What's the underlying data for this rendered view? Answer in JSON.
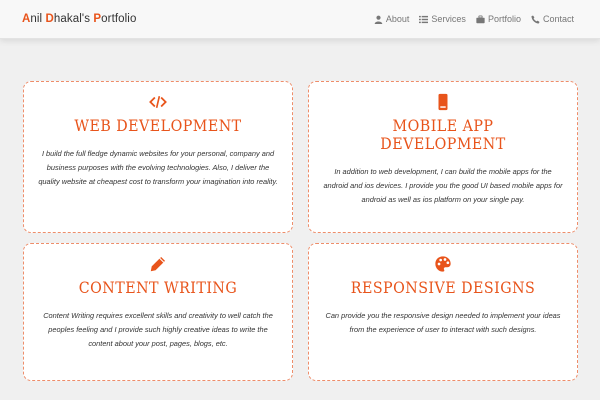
{
  "brand": {
    "c1": "A",
    "r1": "nil ",
    "c2": "D",
    "r2": "hakal's ",
    "c3": "P",
    "r3": "ortfolio"
  },
  "nav": [
    {
      "label": "About",
      "icon": "user-icon"
    },
    {
      "label": "Services",
      "icon": "list-icon"
    },
    {
      "label": "Portfolio",
      "icon": "briefcase-icon"
    },
    {
      "label": "Contact",
      "icon": "phone-icon"
    }
  ],
  "colors": {
    "accent": "#e8541b",
    "card_border": "#ee8d6a",
    "background": "#f0f0f0"
  },
  "services": [
    {
      "icon": "code-icon",
      "title": "Web Development",
      "description": "I build the full fledge dynamic websites for your personal, company and business purposes with the evolving technologies. Also, I deliver the quality website at cheapest cost to transform your imagination into reality."
    },
    {
      "icon": "mobile-icon",
      "title": "Mobile App Development",
      "description": "In addition to web development, I can build the mobile apps for the android and ios devices. I provide you the good UI based mobile apps for android as well as ios platform on your single pay."
    },
    {
      "icon": "pencil-icon",
      "title": "Content Writing",
      "description": "Content Writing requires excellent skills and creativity to well catch the peoples feeling and I provide such highly creative ideas to write the content about your post, pages, blogs, etc."
    },
    {
      "icon": "palette-icon",
      "title": "Responsive Designs",
      "description": "Can provide you the responsive design needed to implement your ideas from the experience of user to interact with such designs."
    }
  ]
}
